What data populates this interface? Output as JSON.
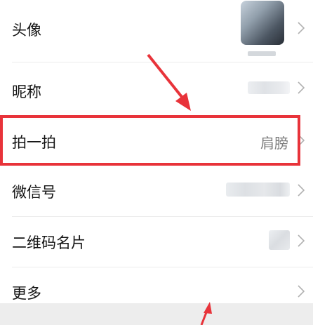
{
  "settings": {
    "rows": [
      {
        "id": "avatar",
        "label": "头像"
      },
      {
        "id": "nickname",
        "label": "昵称"
      },
      {
        "id": "pat",
        "label": "拍一拍",
        "value": "肩膀"
      },
      {
        "id": "wechat_id",
        "label": "微信号"
      },
      {
        "id": "qr_code",
        "label": "二维码名片"
      },
      {
        "id": "more",
        "label": "更多"
      }
    ]
  },
  "annotation": {
    "highlight_color": "#e8333a",
    "arrow_color": "#e8333a"
  },
  "icons": {
    "chevron": "chevron-right-icon"
  }
}
